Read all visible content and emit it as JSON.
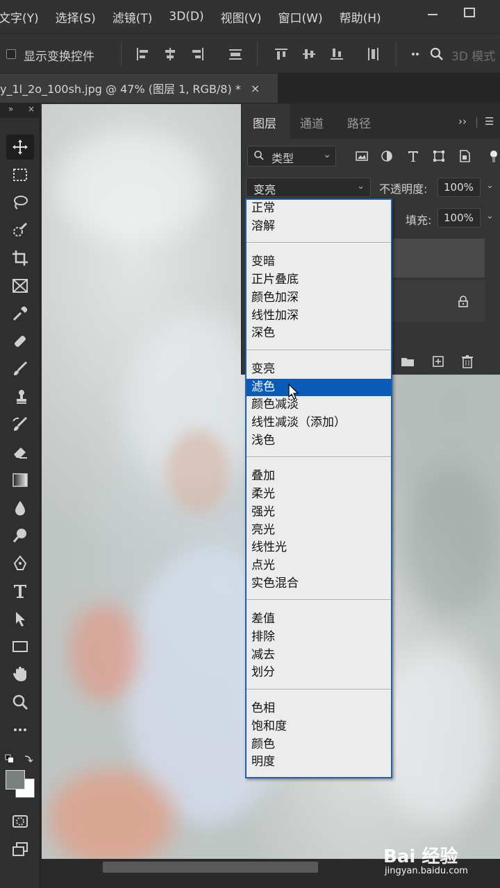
{
  "menubar": {
    "items": [
      "文字(Y)",
      "选择(S)",
      "滤镜(T)",
      "3D(D)",
      "视图(V)",
      "窗口(W)",
      "帮助(H)"
    ]
  },
  "options": {
    "show_transform_label": "显示变换控件",
    "mode_3d_label": "3D 模式"
  },
  "document": {
    "tab_title": "y_1l_2o_100sh.jpg  @  47% (图层 1, RGB/8) *",
    "close_glyph": "×"
  },
  "toolbar": {
    "collapse_glyph": "»",
    "close_glyph": "×",
    "active_tool": "move-tool"
  },
  "layers_panel": {
    "tabs": [
      "图层",
      "通道",
      "路径"
    ],
    "active_tab": "图层",
    "filter_label": "类型",
    "blend_mode": "变亮",
    "opacity_label": "不透明度:",
    "opacity_value": "100%",
    "fill_label": "填充:",
    "fill_value": "100%"
  },
  "blend_dropdown": {
    "groups": [
      [
        "正常",
        "溶解"
      ],
      [
        "变暗",
        "正片叠底",
        "颜色加深",
        "线性加深",
        "深色"
      ],
      [
        "变亮",
        "滤色",
        "颜色减淡",
        "线性减淡（添加）",
        "浅色"
      ],
      [
        "叠加",
        "柔光",
        "强光",
        "亮光",
        "线性光",
        "点光",
        "实色混合"
      ],
      [
        "差值",
        "排除",
        "减去",
        "划分"
      ],
      [
        "色相",
        "饱和度",
        "颜色",
        "明度"
      ]
    ],
    "highlighted": "滤色"
  },
  "watermark": {
    "logo": "Bai 经验",
    "url": "jingyan.baidu.com"
  },
  "colors": {
    "highlight": "#0a5bb8",
    "dropdown_bg": "#ececec",
    "ui_dark": "#323232"
  }
}
